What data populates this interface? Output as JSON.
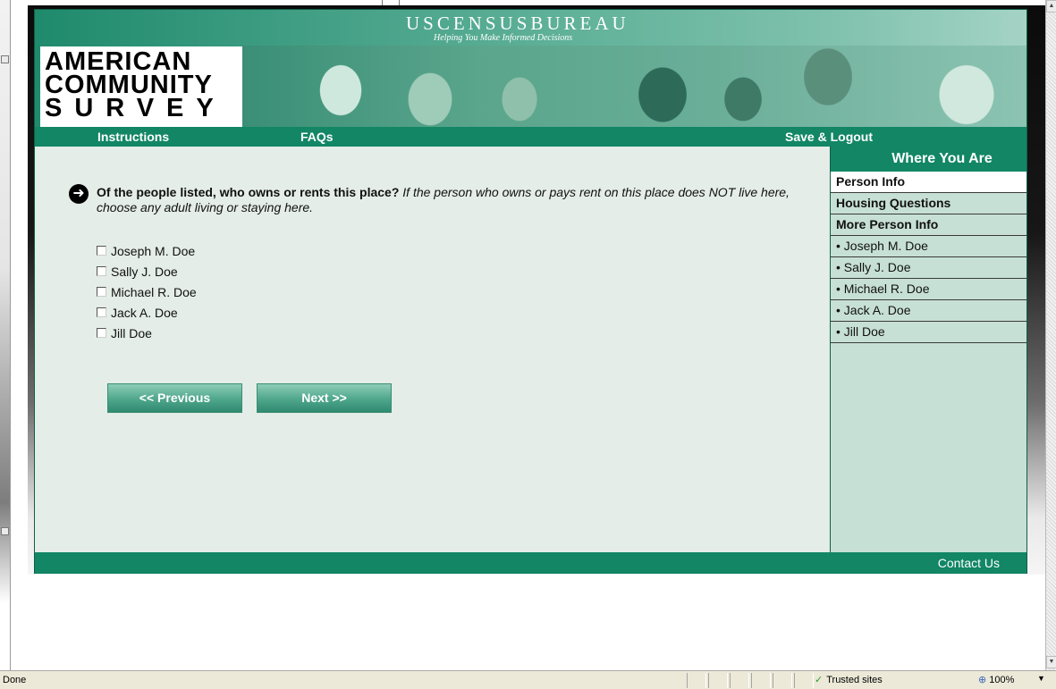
{
  "banner": {
    "agency_title": "USCENSUSBUREAU",
    "tagline": "Helping You Make Informed Decisions",
    "logo_lines": [
      "AMERICAN",
      "COMMUNITY",
      "SURVEY"
    ]
  },
  "nav": {
    "instructions": "Instructions",
    "faqs": "FAQs",
    "save_logout": "Save & Logout"
  },
  "question": {
    "arrow_icon": "➜",
    "bold": "Of the people listed, who owns or rents this place?",
    "italic": "If the person who owns or pays rent on this place does NOT live here, choose any adult living or staying here."
  },
  "options": [
    {
      "label": "Joseph M. Doe",
      "checked": false
    },
    {
      "label": "Sally J. Doe",
      "checked": false
    },
    {
      "label": "Michael R. Doe",
      "checked": false
    },
    {
      "label": "Jack A. Doe",
      "checked": false
    },
    {
      "label": "Jill Doe",
      "checked": false
    }
  ],
  "buttons": {
    "previous": "<<   Previous",
    "next": "Next   >>"
  },
  "sidebar": {
    "header": "Where You Are",
    "items": [
      {
        "label": "Person Info",
        "type": "section",
        "active": true
      },
      {
        "label": "Housing Questions",
        "type": "section",
        "active": false
      },
      {
        "label": "More Person Info",
        "type": "section",
        "active": false
      },
      {
        "label": "• Joseph M. Doe",
        "type": "person",
        "active": false
      },
      {
        "label": "• Sally J. Doe",
        "type": "person",
        "active": false
      },
      {
        "label": "• Michael R. Doe",
        "type": "person",
        "active": false
      },
      {
        "label": "• Jack A. Doe",
        "type": "person",
        "active": false
      },
      {
        "label": "• Jill Doe",
        "type": "person",
        "active": false
      }
    ]
  },
  "footer": {
    "contact": "Contact Us"
  },
  "status": {
    "text": "Done",
    "zone": "Trusted sites",
    "zone_icon": "checkmark-icon",
    "zoom": "100%"
  },
  "colors": {
    "brand_green": "#128665",
    "panel_bg": "#e4ede8",
    "sidebar_bg": "#c7e0d6"
  }
}
